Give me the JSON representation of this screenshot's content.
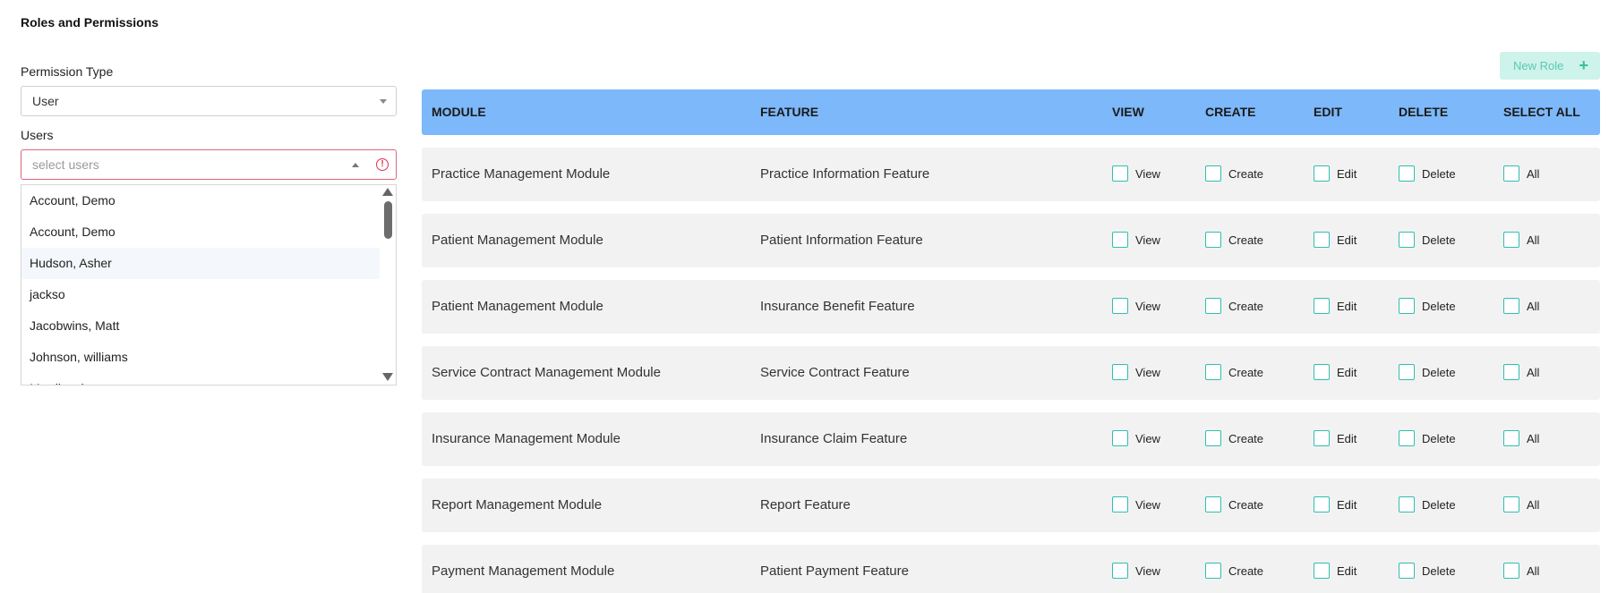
{
  "page": {
    "title": "Roles and Permissions"
  },
  "permission_type": {
    "label": "Permission Type",
    "value": "User"
  },
  "users": {
    "label": "Users",
    "placeholder": "select users",
    "options": [
      "Account, Demo",
      "Account, Demo",
      "Hudson, Asher",
      "jackso",
      "Jacobwins, Matt",
      "Johnson, williams",
      "Merrlin, shaan"
    ]
  },
  "new_role": {
    "label": "New Role",
    "icon": "plus-icon"
  },
  "table": {
    "headers": {
      "module": "MODULE",
      "feature": "FEATURE",
      "view": "VIEW",
      "create": "CREATE",
      "edit": "EDIT",
      "delete": "DELETE",
      "select_all": "SELECT ALL"
    },
    "checkbox_labels": {
      "view": "View",
      "create": "Create",
      "edit": "Edit",
      "delete": "Delete",
      "all": "All"
    },
    "rows": [
      {
        "module": "Practice Management Module",
        "feature": "Practice Information Feature"
      },
      {
        "module": "Patient Management Module",
        "feature": "Patient Information Feature"
      },
      {
        "module": "Patient Management Module",
        "feature": "Insurance Benefit Feature"
      },
      {
        "module": "Service Contract Management Module",
        "feature": "Service Contract Feature"
      },
      {
        "module": "Insurance Management Module",
        "feature": "Insurance Claim Feature"
      },
      {
        "module": "Report Management Module",
        "feature": "Report Feature"
      },
      {
        "module": "Payment Management Module",
        "feature": "Patient Payment Feature"
      }
    ]
  },
  "colors": {
    "header_bg": "#7db8fa",
    "row_bg": "#f2f2f2",
    "checkbox_border": "#2fbfb0",
    "error_border": "#e0637d",
    "new_role_bg": "#cdf3ea"
  }
}
